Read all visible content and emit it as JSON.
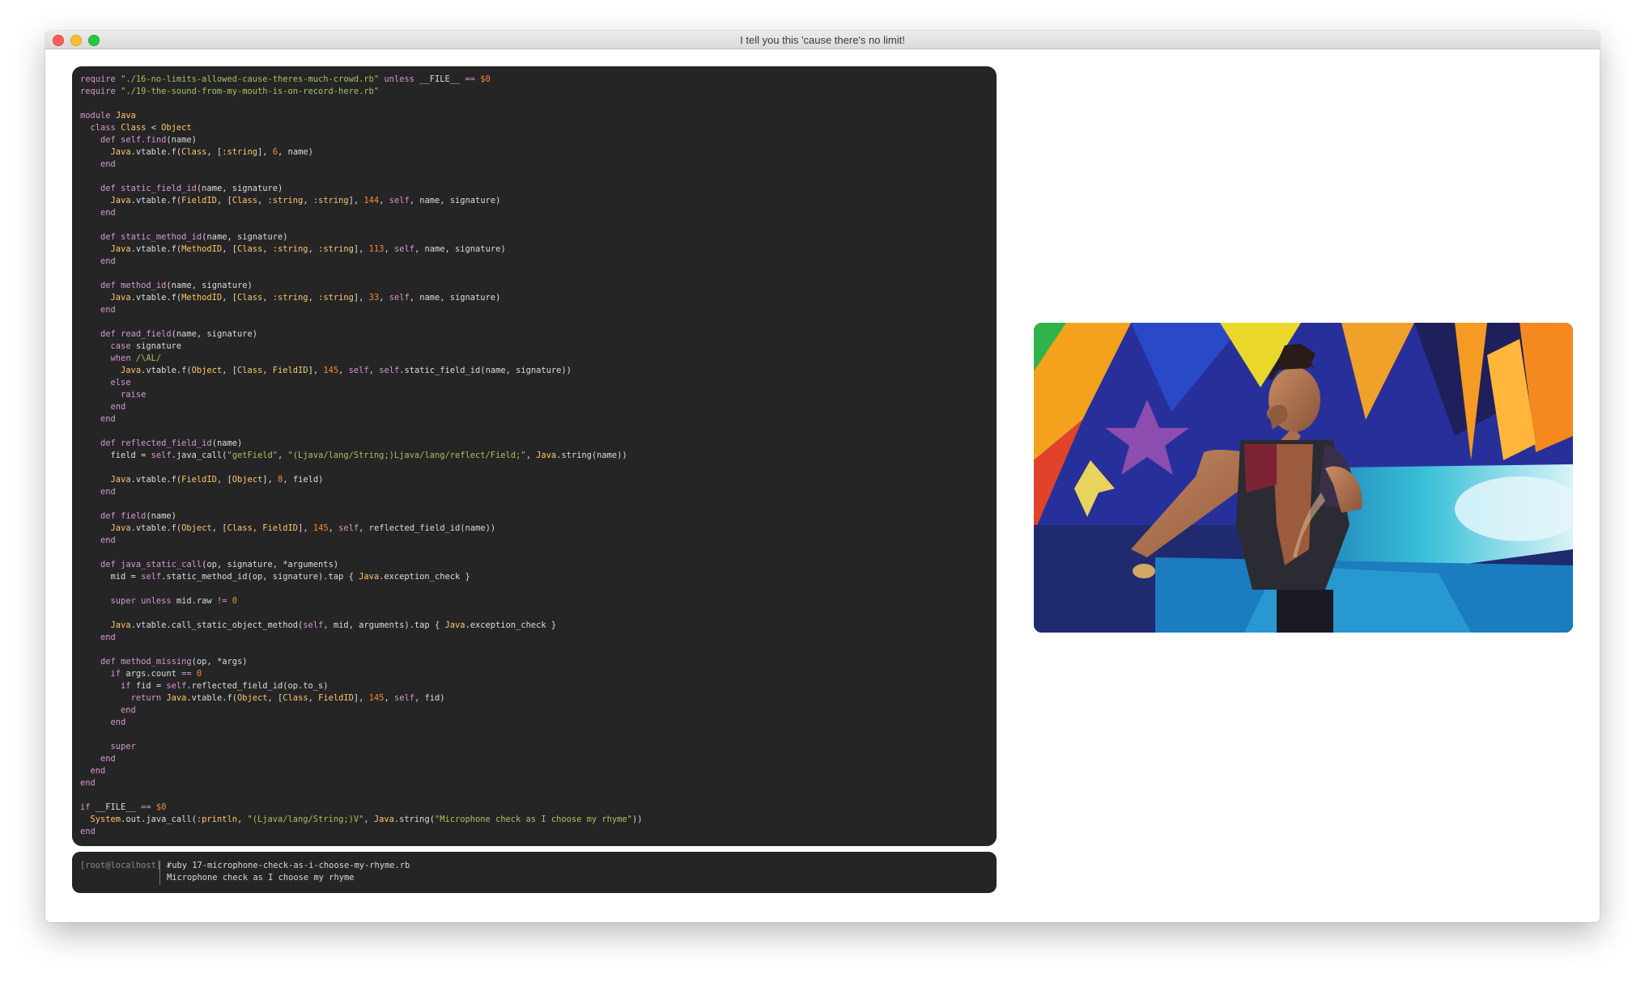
{
  "window": {
    "title": "I tell you this 'cause there's no limit!"
  },
  "terminal": {
    "prompt": "[root@localhost] #",
    "command": "ruby 17-microphone-check-as-i-choose-my-rhyme.rb",
    "output": "Microphone check as I choose my rhyme"
  },
  "video": {
    "description_icon": "video-frame"
  },
  "colors": {
    "editor_bg": "#252525",
    "keyword": "#d895d6",
    "constant": "#ffc66d",
    "string": "#a5c261",
    "number": "#f28a3c"
  }
}
